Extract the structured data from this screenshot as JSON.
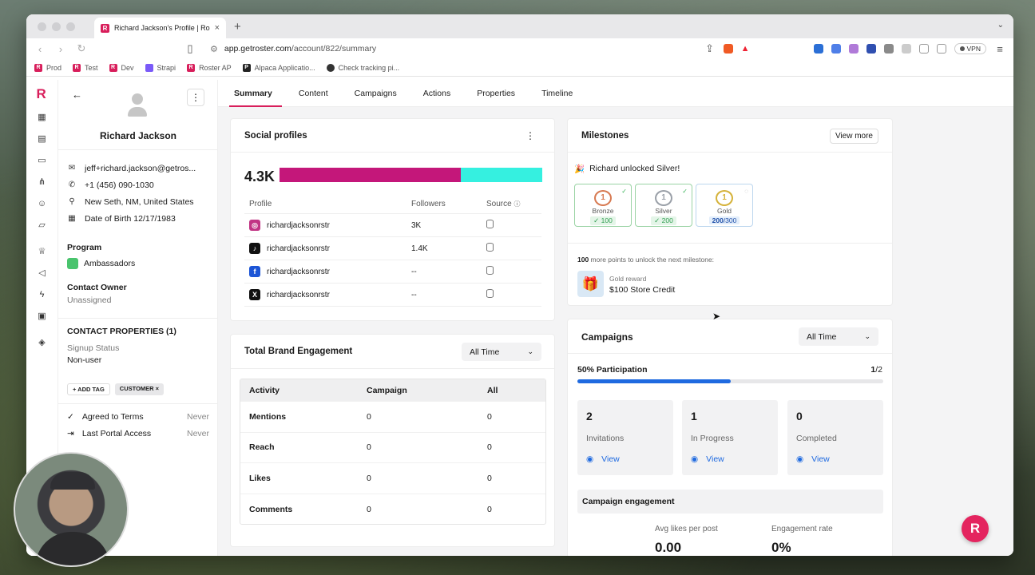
{
  "browser": {
    "tab_title": "Richard Jackson's Profile | Ro",
    "url_domain": "app.getroster.com",
    "url_path": "/account/822/summary",
    "vpn": "VPN",
    "bookmarks": [
      "Prod",
      "Test",
      "Dev",
      "Strapi",
      "Roster AP",
      "Alpaca Applicatio...",
      "Check tracking pi..."
    ]
  },
  "profile": {
    "name": "Richard Jackson",
    "email": "jeff+richard.jackson@getros...",
    "phone": "+1 (456) 090-1030",
    "location": "New Seth, NM, United States",
    "dob": "Date of Birth 12/17/1983",
    "program_label": "Program",
    "program_value": "Ambassadors",
    "owner_label": "Contact Owner",
    "owner_value": "Unassigned",
    "props_label": "CONTACT PROPERTIES (1)",
    "signup_label": "Signup Status",
    "signup_value": "Non-user",
    "add_tag": "+ ADD TAG",
    "tag": "CUSTOMER ×",
    "agreed_label": "Agreed to Terms",
    "agreed_value": "Never",
    "portal_label": "Last Portal Access",
    "portal_value": "Never"
  },
  "nav": {
    "tabs": [
      "Summary",
      "Content",
      "Campaigns",
      "Actions",
      "Properties",
      "Timeline"
    ],
    "active": "Summary"
  },
  "social": {
    "title": "Social profiles",
    "total": "4.3K",
    "split": {
      "magenta_fraction": 0.69
    },
    "colors": {
      "magenta": "#c4177a",
      "cyan": "#35f0e0"
    },
    "headers": [
      "Profile",
      "Followers",
      "Source"
    ],
    "rows": [
      {
        "icon": "instagram-icon",
        "handle": "richardjacksonrstr",
        "followers": "3K"
      },
      {
        "icon": "tiktok-icon",
        "handle": "richardjacksonrstr",
        "followers": "1.4K"
      },
      {
        "icon": "facebook-icon",
        "handle": "richardjacksonrstr",
        "followers": "--"
      },
      {
        "icon": "x-icon",
        "handle": "richardjacksonrstr",
        "followers": "--"
      }
    ]
  },
  "engagement": {
    "title": "Total Brand Engagement",
    "range": "All Time",
    "headers": [
      "Activity",
      "Campaign",
      "All"
    ],
    "rows": [
      {
        "activity": "Mentions",
        "campaign": "0",
        "all": "0"
      },
      {
        "activity": "Reach",
        "campaign": "0",
        "all": "0"
      },
      {
        "activity": "Likes",
        "campaign": "0",
        "all": "0"
      },
      {
        "activity": "Comments",
        "campaign": "0",
        "all": "0"
      }
    ]
  },
  "milestones": {
    "title": "Milestones",
    "view_more": "View more",
    "unlocked": "Richard unlocked Silver!",
    "badges": [
      {
        "name": "Bronze",
        "points": "100",
        "done": true
      },
      {
        "name": "Silver",
        "points": "200",
        "done": true
      },
      {
        "name": "Gold",
        "progress": "200",
        "target": "/300",
        "done": false
      }
    ],
    "next_points": "100",
    "next_text": " more points to unlock the next milestone:",
    "reward_label": "Gold reward",
    "reward_value": "$100 Store Credit"
  },
  "campaigns": {
    "title": "Campaigns",
    "range": "All Time",
    "participation": "50% Participation",
    "progress_fraction": 0.5,
    "count_done": "1",
    "count_total": "/2",
    "stats": [
      {
        "num": "2",
        "label": "Invitations",
        "action": "View"
      },
      {
        "num": "1",
        "label": "In Progress",
        "action": "View"
      },
      {
        "num": "0",
        "label": "Completed",
        "action": "View"
      }
    ],
    "engagement_title": "Campaign engagement",
    "avg_likes_label": "Avg likes per post",
    "avg_likes_value": "0.00",
    "eng_rate_label": "Engagement rate",
    "eng_rate_value": "0%"
  },
  "brand_color": "#d81e5b"
}
